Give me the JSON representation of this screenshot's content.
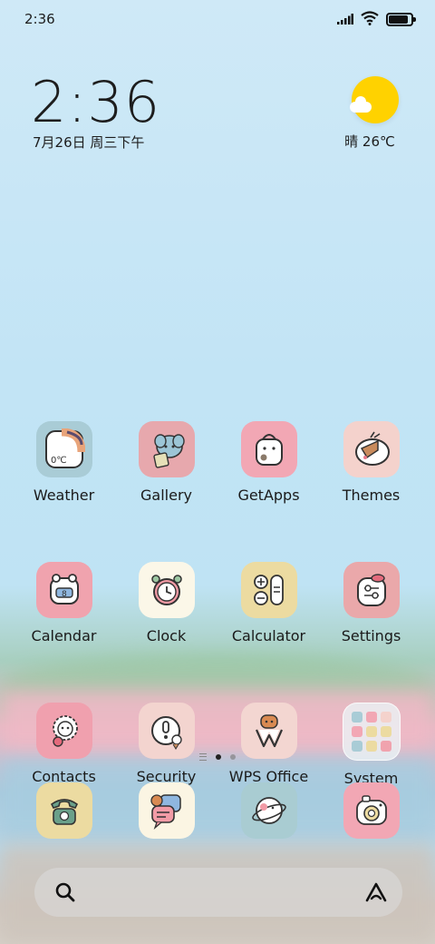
{
  "status_bar": {
    "time": "2:36",
    "battery_level": 0.95
  },
  "clock_widget": {
    "time": "2:36",
    "date": "7月26日 周三下午"
  },
  "weather_widget": {
    "condition_temp": "晴 26℃",
    "icon": "sun-with-cloud-icon"
  },
  "apps": [
    {
      "label": "Weather",
      "icon": "weather-icon",
      "bg": "#a9ccd6"
    },
    {
      "label": "Gallery",
      "icon": "gallery-icon",
      "bg": "#e7a8ad"
    },
    {
      "label": "GetApps",
      "icon": "getapps-icon",
      "bg": "#f2a7b4"
    },
    {
      "label": "Themes",
      "icon": "themes-icon",
      "bg": "#f4d2cc"
    },
    {
      "label": "Calendar",
      "icon": "calendar-icon",
      "bg": "#f0a3ae"
    },
    {
      "label": "Clock",
      "icon": "clock-icon",
      "bg": "#fbf7e8"
    },
    {
      "label": "Calculator",
      "icon": "calculator-icon",
      "bg": "#ecdba1"
    },
    {
      "label": "Settings",
      "icon": "settings-icon",
      "bg": "#eaa8aa"
    },
    {
      "label": "Contacts",
      "icon": "contacts-icon",
      "bg": "#f0a0ae"
    },
    {
      "label": "Security",
      "icon": "security-icon",
      "bg": "#f3d4cf"
    },
    {
      "label": "WPS Office",
      "icon": "wps-office-icon",
      "bg": "#f3d6d1"
    },
    {
      "label": "System",
      "icon": "system-folder-icon",
      "bg": "#e3ecef"
    }
  ],
  "dock": [
    {
      "icon": "phone-icon",
      "bg": "#ecdba1"
    },
    {
      "icon": "messaging-icon",
      "bg": "#fbf5e3"
    },
    {
      "icon": "browser-icon",
      "bg": "#a9ccd2"
    },
    {
      "icon": "camera-icon",
      "bg": "#f2a7b4"
    }
  ],
  "pager": {
    "pages": 2,
    "active_index": 0
  }
}
